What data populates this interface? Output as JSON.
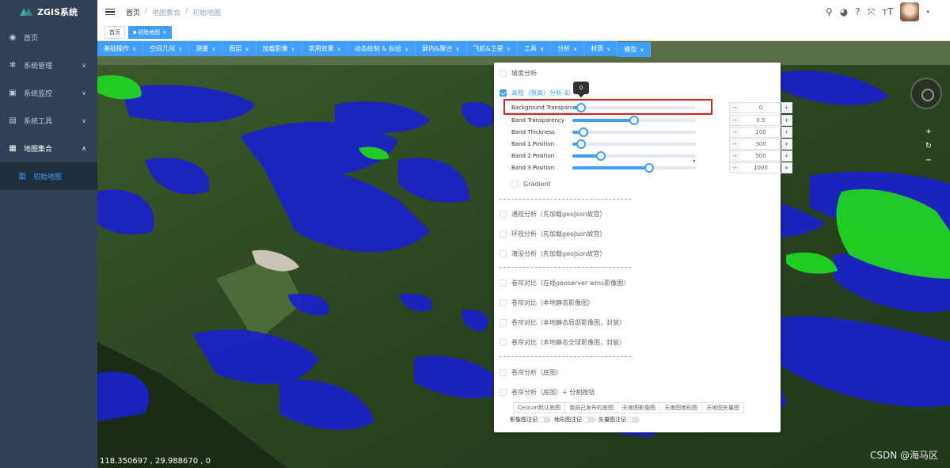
{
  "sidebar": {
    "logo": "ZGIS系统",
    "items": [
      {
        "label": "首页",
        "icon": "dashboard-icon",
        "has_arrow": false
      },
      {
        "label": "系统管理",
        "icon": "gear-icon",
        "has_arrow": true
      },
      {
        "label": "系统监控",
        "icon": "monitor-icon",
        "has_arrow": true
      },
      {
        "label": "系统工具",
        "icon": "toolbox-icon",
        "has_arrow": true
      },
      {
        "label": "地图集合",
        "icon": "map-collection-icon",
        "has_arrow": true,
        "open": true
      }
    ],
    "submenu": [
      {
        "label": "初始地图",
        "icon": "map-icon"
      }
    ]
  },
  "header": {
    "breadcrumb": [
      "首页",
      "地图集合",
      "初始地图"
    ],
    "icons": [
      "search-icon",
      "github-icon",
      "help-icon",
      "fullscreen-icon",
      "font-size-icon"
    ]
  },
  "tags": [
    {
      "label": "首页",
      "active": false
    },
    {
      "label": "初始地图",
      "active": true,
      "close": "×"
    }
  ],
  "toolbar": [
    "基础操作",
    "空间几何",
    "测量",
    "图层",
    "加载影像",
    "常用效果",
    "动态绘制 & 标绘",
    "屏内&聚合",
    "飞机&卫星",
    "工具",
    "分析",
    "材质",
    "模型"
  ],
  "panel": {
    "slope_label": "坡度分析",
    "elevation_label": "高程（限高）分析-彩",
    "tooltip_value": "0",
    "sliders": [
      {
        "label": "Background Transparency",
        "value": "0",
        "fraction": 0.07
      },
      {
        "label": "Band Transparency",
        "value": "0.5",
        "fraction": 0.5
      },
      {
        "label": "Band Thickness",
        "value": "100",
        "fraction": 0.09
      },
      {
        "label": "Band 1 Position",
        "value": "300",
        "fraction": 0.07
      },
      {
        "label": "Band 2 Position",
        "value": "500",
        "fraction": 0.23
      },
      {
        "label": "Band 3 Position",
        "value": "1000",
        "fraction": 0.62
      }
    ],
    "stepper_minus": "−",
    "stepper_plus": "+",
    "gradient_label": "Gradient",
    "analysis_items": [
      "通视分析（先加载geoJson故宫）",
      "环视分析（先加载geoJson故宫）",
      "淹没分析（先加载geoJson故宫）"
    ],
    "compare_items": [
      "卷帘对比（在线geoserver wms影像图）",
      "卷帘对比（本地静态影像图）",
      "卷帘对比（本地静态局部影像图，封装）",
      "卷帘对比（本地静态全球影像图，封装）"
    ],
    "split_items": [
      "卷帘分析（底图）",
      "卷帘分析（底图）+ 分割按钮"
    ],
    "basemap_buttons": [
      "Cesium默认底图",
      "我自己发布的底图",
      "天地图影像图",
      "天地图地形图",
      "天地图矢量图"
    ],
    "switches": [
      "影像图注记",
      "地形图注记",
      "矢量图注记"
    ]
  },
  "map": {
    "coords": "118.350697 ,   29.988670 ,   0",
    "watermark": "CSDN @海马区",
    "zoom": [
      "+",
      "↻",
      "−"
    ]
  },
  "colors": {
    "sidebar_bg": "#304156",
    "accent": "#409eff",
    "terrain": "#2f4a22",
    "band_blue": "#1a22c8",
    "band_green": "#22d322",
    "highlight_red": "#e02020"
  }
}
